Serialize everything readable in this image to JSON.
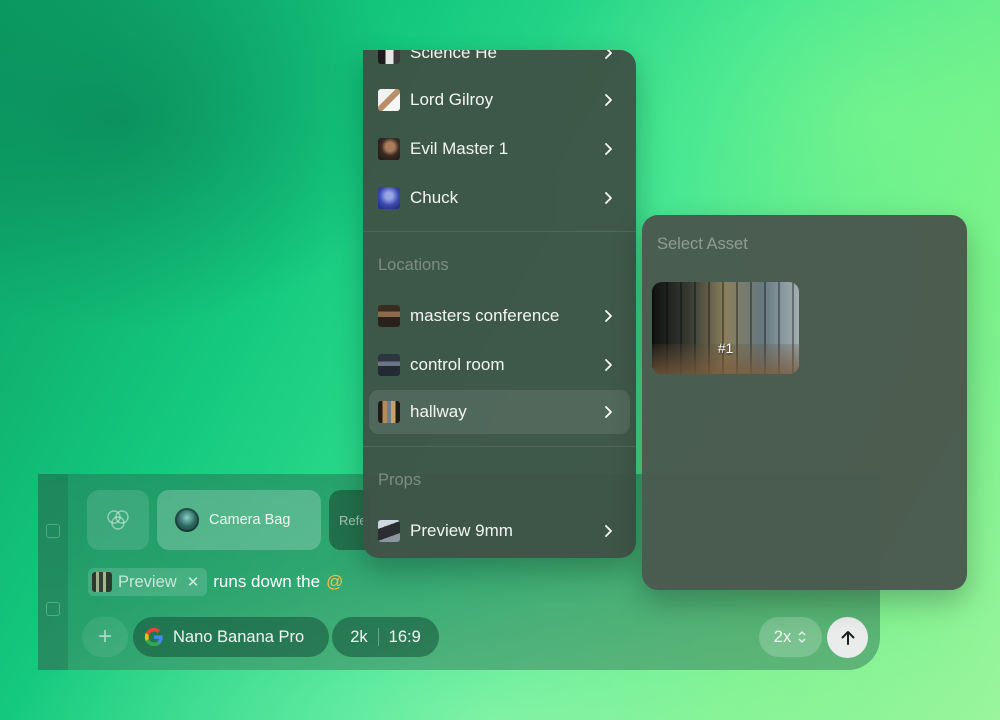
{
  "composer": {
    "chips": [
      {
        "label": "",
        "icon": "circles-icon"
      },
      {
        "label": "Camera Bag"
      },
      {
        "label": "Refe"
      }
    ],
    "prompt": {
      "mention_label": "Preview",
      "text": "runs down the",
      "trigger": "@"
    },
    "model": {
      "name": "Nano Banana Pro",
      "icon": "google-logo-icon"
    },
    "resolution": "2k",
    "aspect_ratio": "16:9",
    "count": "2x"
  },
  "menu": {
    "characters": [
      {
        "label": "Science He"
      },
      {
        "label": "Lord Gilroy"
      },
      {
        "label": "Evil Master 1"
      },
      {
        "label": "Chuck"
      }
    ],
    "locations_header": "Locations",
    "locations": [
      {
        "label": "masters conference"
      },
      {
        "label": "control room"
      },
      {
        "label": "hallway",
        "active": true
      }
    ],
    "props_header": "Props",
    "props": [
      {
        "label": "Preview 9mm"
      }
    ]
  },
  "asset_panel": {
    "title": "Select Asset",
    "assets": [
      {
        "label": "#1"
      }
    ]
  },
  "colors": {
    "accent_at": "#f3c24a",
    "menu_bg": "#3e5246",
    "panel_bg": "#4a584e"
  }
}
